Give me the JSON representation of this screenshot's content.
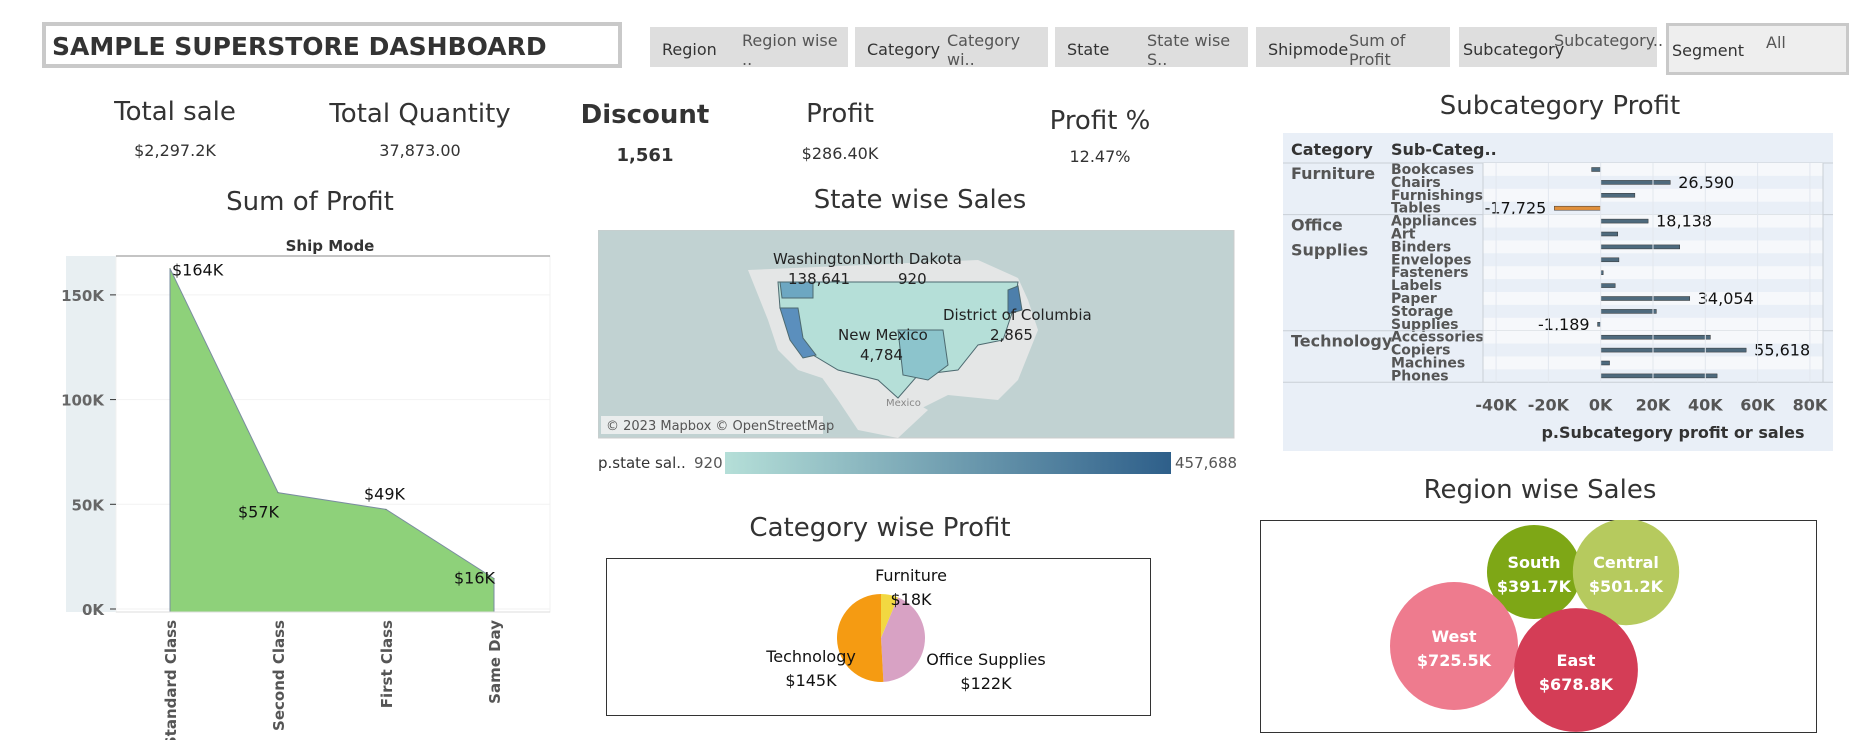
{
  "header": {
    "title": "SAMPLE SUPERSTORE DASHBOARD"
  },
  "filters": [
    {
      "label": "Region",
      "value": "Region wise .."
    },
    {
      "label": "Category",
      "value": "Category wi.."
    },
    {
      "label": "State",
      "value": "State wise S.."
    },
    {
      "label": "Shipmode",
      "value": "Sum of Profit"
    },
    {
      "label": "Subcategory",
      "value": "Subcategory.."
    },
    {
      "label": "Segment",
      "value": "All"
    }
  ],
  "kpis": [
    {
      "title": "Total sale",
      "value": "$2,297.2K"
    },
    {
      "title": "Total Quantity",
      "value": "37,873.00"
    },
    {
      "title": "Discount",
      "value": "1,561"
    },
    {
      "title": "Profit",
      "value": "$286.40K"
    },
    {
      "title": "Profit %",
      "value": "12.47%"
    }
  ],
  "sections": {
    "sum_profit": "Sum of Profit",
    "state_sales": "State wise Sales",
    "subcat_profit": "Subcategory Profit",
    "category_profit": "Category wise Profit",
    "region_sales": "Region wise Sales"
  },
  "map": {
    "attribution": "© 2023 Mapbox © OpenStreetMap",
    "mexico_label": "Mexico",
    "legend_label": "p.state sal..",
    "legend_min": "920",
    "legend_max": "457,688",
    "legend_colors": [
      "#b5dfd8",
      "#2e5f8a"
    ],
    "labels": [
      {
        "name": "Washington",
        "value": "138,641"
      },
      {
        "name": "North Dakota",
        "value": "920"
      },
      {
        "name": "New Mexico",
        "value": "4,784"
      },
      {
        "name": "District of Columbia",
        "value": "2,865"
      }
    ]
  },
  "chart_data": [
    {
      "type": "area",
      "title": "Sum of Profit",
      "xlabel": "Ship Mode",
      "categories": [
        "Standard Class",
        "Second Class",
        "First Class",
        "Same Day"
      ],
      "values": [
        164,
        57,
        49,
        16
      ],
      "data_labels": [
        "$164K",
        "$57K",
        "$49K",
        "$16K"
      ],
      "yticks": [
        "0K",
        "50K",
        "100K",
        "150K"
      ],
      "ylim": [
        0,
        170
      ],
      "fill_color": "#8ed17a"
    },
    {
      "type": "bar",
      "title": "Subcategory Profit",
      "headers": [
        "Category",
        "Sub-Categ.."
      ],
      "xlabel": "p.Subcategory profit or sales",
      "xticks": [
        "-40K",
        "-20K",
        "0K",
        "20K",
        "40K",
        "60K",
        "80K"
      ],
      "xlim": [
        -45000,
        85000
      ],
      "groups": [
        {
          "category": "Furniture",
          "items": [
            {
              "name": "Bookcases",
              "value": -3473
            },
            {
              "name": "Chairs",
              "value": 26590,
              "label": "26,590"
            },
            {
              "name": "Furnishings",
              "value": 13059
            },
            {
              "name": "Tables",
              "value": -17725,
              "label": "-17,725"
            }
          ]
        },
        {
          "category": "Office Supplies",
          "items": [
            {
              "name": "Appliances",
              "value": 18138,
              "label": "18,138"
            },
            {
              "name": "Art",
              "value": 6528
            },
            {
              "name": "Binders",
              "value": 30222
            },
            {
              "name": "Envelopes",
              "value": 6964
            },
            {
              "name": "Fasteners",
              "value": 950
            },
            {
              "name": "Labels",
              "value": 5546
            },
            {
              "name": "Paper",
              "value": 34054,
              "label": "34,054"
            },
            {
              "name": "Storage",
              "value": 21279
            },
            {
              "name": "Supplies",
              "value": -1189,
              "label": "-1,189"
            }
          ]
        },
        {
          "category": "Technology",
          "items": [
            {
              "name": "Accessories",
              "value": 41937
            },
            {
              "name": "Copiers",
              "value": 55618,
              "label": "55,618"
            },
            {
              "name": "Machines",
              "value": 3385
            },
            {
              "name": "Phones",
              "value": 44516
            }
          ]
        }
      ]
    },
    {
      "type": "pie",
      "title": "Category wise Profit",
      "slices": [
        {
          "name": "Furniture",
          "value": 18,
          "label": "$18K",
          "color": "#f2d841"
        },
        {
          "name": "Office Supplies",
          "value": 122,
          "label": "$122K",
          "color": "#d8a2c4"
        },
        {
          "name": "Technology",
          "value": 145,
          "label": "$145K",
          "color": "#f59b12"
        }
      ]
    },
    {
      "type": "bubble",
      "title": "Region wise Sales",
      "bubbles": [
        {
          "name": "South",
          "value": 391.7,
          "label": "$391.7K",
          "color": "#7ea716"
        },
        {
          "name": "Central",
          "value": 501.2,
          "label": "$501.2K",
          "color": "#b6ca5e"
        },
        {
          "name": "West",
          "value": 725.5,
          "label": "$725.5K",
          "color": "#ee7b8e"
        },
        {
          "name": "East",
          "value": 678.8,
          "label": "$678.8K",
          "color": "#d43d56"
        }
      ]
    }
  ]
}
